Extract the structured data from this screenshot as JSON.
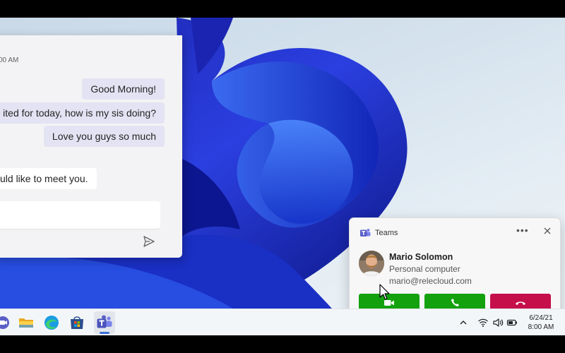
{
  "chat": {
    "timestamp": "00 AM",
    "messages": [
      {
        "text": "Good Morning!"
      },
      {
        "text": "ited for today, how is my sis doing?"
      },
      {
        "text": "Love you guys so much"
      },
      {
        "text": "uld like to meet you."
      }
    ],
    "compose_value": ""
  },
  "toast": {
    "app_name": "Teams",
    "more_label": "•••",
    "caller_name": "Mario Solomon",
    "caller_device": "Personal computer",
    "caller_email": "mario@relecloud.com",
    "buttons": [
      {
        "action": "accept-video",
        "icon": "video-camera-icon",
        "color": "#13a10e"
      },
      {
        "action": "accept-audio",
        "icon": "phone-icon",
        "color": "#13a10e"
      },
      {
        "action": "decline",
        "icon": "hang-up-icon",
        "color": "#c50f4b"
      }
    ]
  },
  "taskbar": {
    "apps": [
      {
        "name": "partial-app-icon"
      },
      {
        "name": "file-explorer-icon"
      },
      {
        "name": "edge-browser-icon"
      },
      {
        "name": "microsoft-store-icon"
      },
      {
        "name": "teams-icon",
        "active": true
      }
    ],
    "tray": [
      "chevron-up-icon",
      "wifi-icon",
      "volume-icon",
      "battery-icon"
    ],
    "clock": {
      "date": "6/24/21",
      "time": "8:00 AM"
    }
  },
  "colors": {
    "accept": "#13a10e",
    "decline": "#c50f4b",
    "teams_purple": "#5b5fc7",
    "bubble": "#e3e3f3"
  }
}
